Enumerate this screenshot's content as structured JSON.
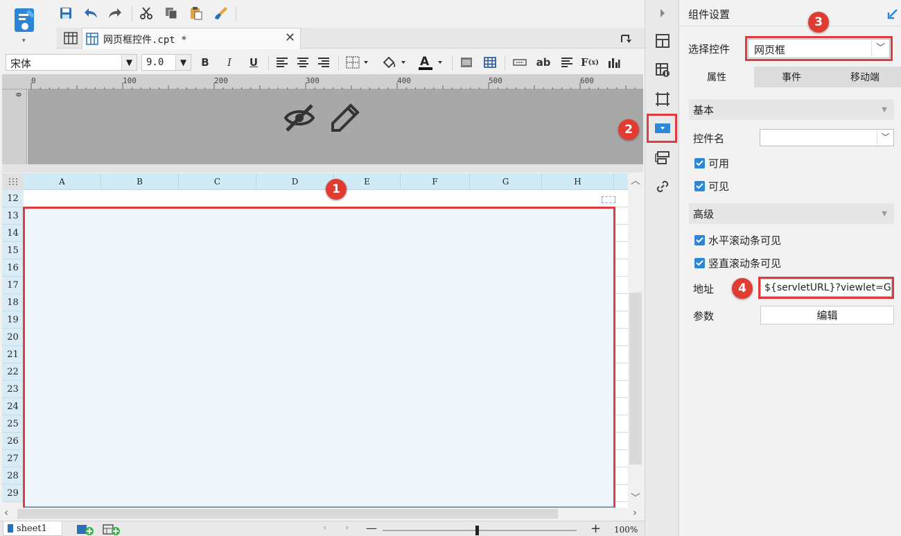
{
  "editor": {
    "tab_title": "网页框控件.cpt *",
    "font_name": "宋体",
    "font_size": "9.0",
    "ruler_labels": [
      "0",
      "100",
      "200",
      "300",
      "400",
      "500",
      "600"
    ],
    "ruler_v_label": "0",
    "columns": [
      "A",
      "B",
      "C",
      "D",
      "E",
      "F",
      "G",
      "H"
    ],
    "rows": [
      "12",
      "13",
      "14",
      "15",
      "16",
      "17",
      "18",
      "19",
      "20",
      "21",
      "22",
      "23",
      "24",
      "25",
      "26",
      "27",
      "28",
      "29"
    ],
    "sheet_name": "sheet1",
    "zoom": "100%",
    "badge_1": "1"
  },
  "strip": {
    "badge_2": "2"
  },
  "panel": {
    "title": "组件设置",
    "select_label": "选择控件",
    "select_value": "网页框",
    "badge_3": "3",
    "tabs": [
      "属性",
      "事件",
      "移动端"
    ],
    "basic_section": "基本",
    "name_label": "控件名",
    "name_value": "",
    "enabled_label": "可用",
    "visible_label": "可见",
    "advanced_section": "高级",
    "hscroll_label": "水平滚动条可见",
    "vscroll_label": "竖直滚动条可见",
    "address_label": "地址",
    "address_value": "${servletURL}?viewlet=Gc",
    "badge_4": "4",
    "param_label": "参数",
    "edit_button": "编辑"
  },
  "colors": {
    "accent": "#2d86d6",
    "badge": "#e03c31",
    "highlight": "#e0393e",
    "selection_fill": "#eef6fc"
  }
}
